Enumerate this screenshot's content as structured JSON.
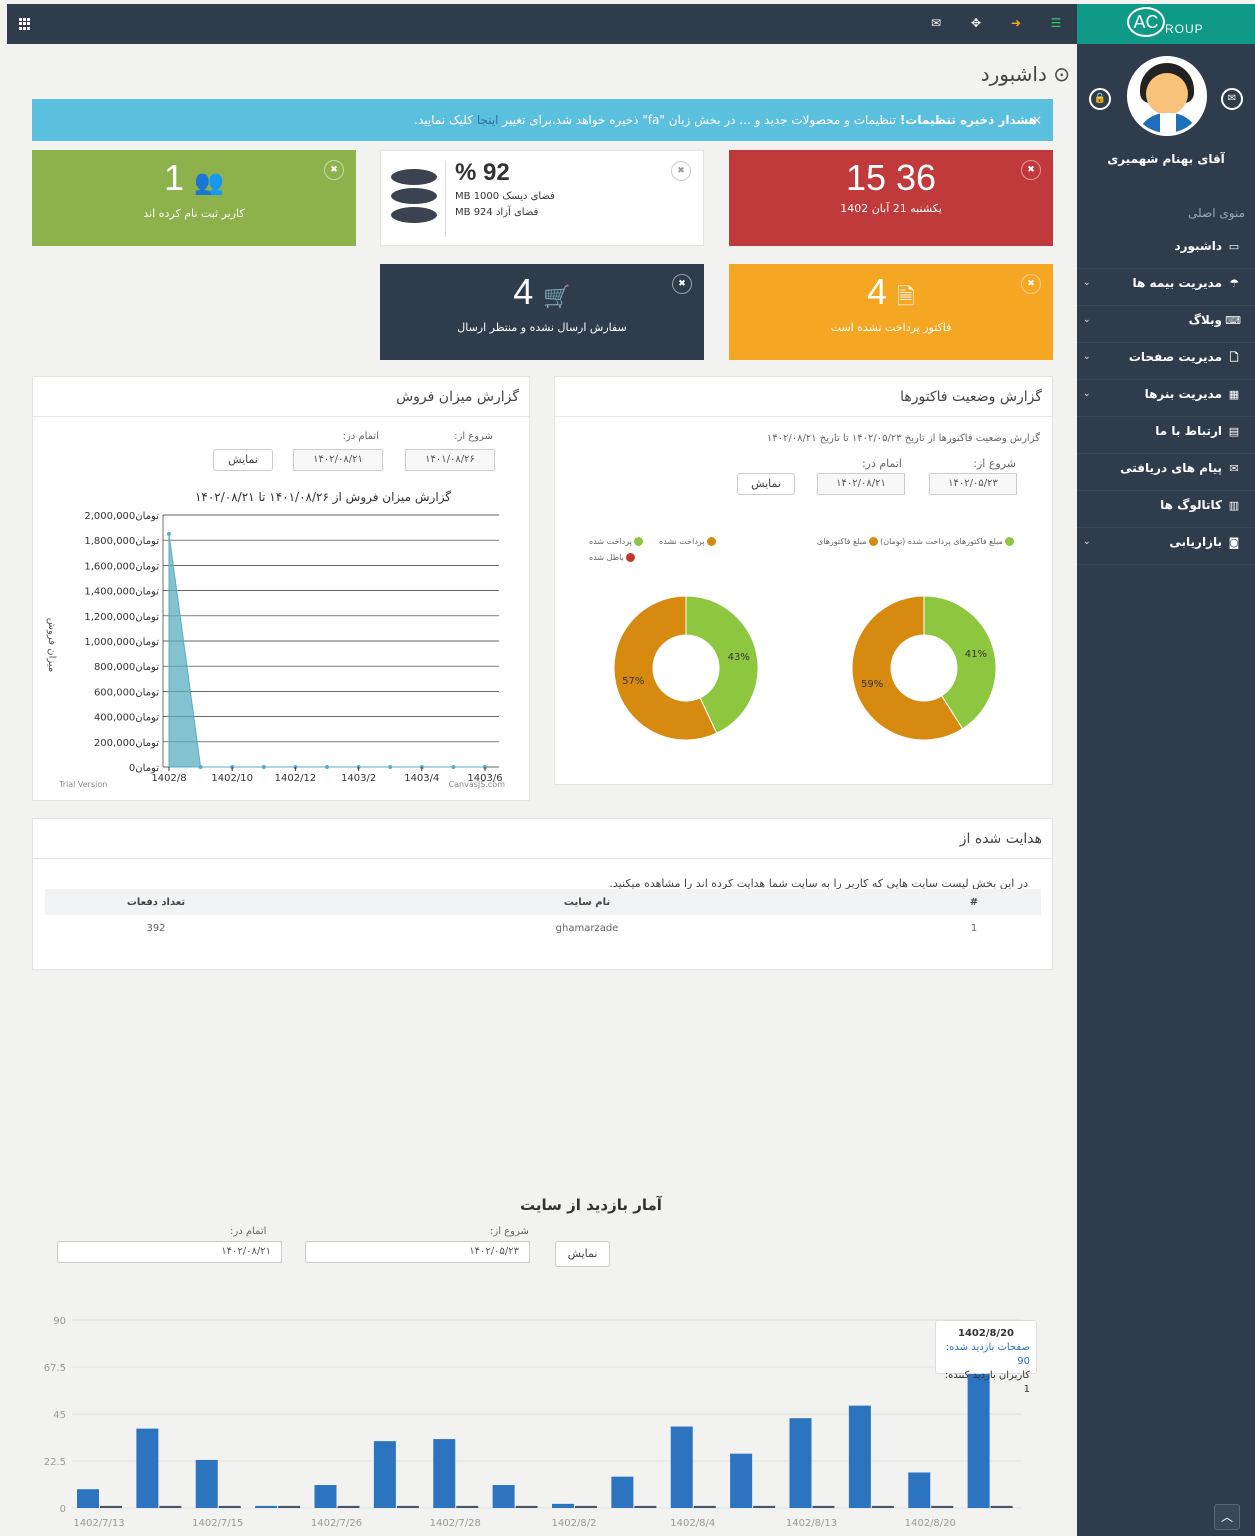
{
  "header": {
    "icons": [
      "apps-grid-icon",
      "envelope-icon",
      "crosshair-icon",
      "logout-icon",
      "list-icon"
    ]
  },
  "sidebar": {
    "logo_main": "AC",
    "logo_sub": "ROUP",
    "username": "آقای بهنام شهمیری",
    "menu_title": "منوی اصلی",
    "items": [
      {
        "label": "داشبورد",
        "icon": "monitor-icon",
        "has_sub": false
      },
      {
        "label": "مدیریت بیمه ها",
        "icon": "umbrella-icon",
        "has_sub": true
      },
      {
        "label": "وبلاگ",
        "icon": "keyboard-icon",
        "has_sub": true
      },
      {
        "label": "مدیریت صفحات",
        "icon": "file-icon",
        "has_sub": true
      },
      {
        "label": "مدیریت بنرها",
        "icon": "film-icon",
        "has_sub": true
      },
      {
        "label": "ارتباط با ما",
        "icon": "card-icon",
        "has_sub": false
      },
      {
        "label": "پیام های دریافتی",
        "icon": "envelope-icon",
        "has_sub": false
      },
      {
        "label": "کاتالوگ ها",
        "icon": "list-icon",
        "has_sub": false
      },
      {
        "label": "بازاریابی",
        "icon": "camera-icon",
        "has_sub": true
      }
    ]
  },
  "page": {
    "title": "داشبورد"
  },
  "alert": {
    "strong": "هشدار ذخیره تنظیمات!",
    "text": " تنظیمات و محصولات جدید و ... در بخش زبان \"fa\" ذخیره خواهد شد.برای تغییر ",
    "link": "اینجا",
    "tail": " کلیک نمایید."
  },
  "tiles": {
    "time": {
      "big": "15 36",
      "small": "یکشنبه 21 آبان 1402"
    },
    "disk": {
      "pct": "% 92",
      "line1": "فضای دیسک 1000 MB",
      "line2": "فضای آزاد 924 MB"
    },
    "users": {
      "big": "1",
      "small": "کاربر ثبت نام کرده اند"
    },
    "invoices": {
      "big": "4",
      "small": "فاکتور پرداخت نشده است"
    },
    "orders": {
      "big": "4",
      "small": "سفارش ارسال نشده و منتظر ارسال"
    }
  },
  "sales": {
    "title": "گزارش میزان فروش",
    "from_label": "شروع از:",
    "to_label": "اتمام در:",
    "from": "۱۴۰۱/۰۸/۲۶",
    "to": "۱۴۰۲/۰۸/۲۱",
    "button": "نمایش",
    "chart_title": "گزارش میزان فروش از ۱۴۰۱/۰۸/۲۶ تا ۱۴۰۲/۰۸/۲۱",
    "ylabel": "میزان فروش",
    "footer_left": "Trial Version",
    "footer_right": "CanvasJS.com"
  },
  "invoices": {
    "title": "گزارش وضعیت فاکتورها",
    "subtitle": "گزارش وضعیت فاکتورها از تاریخ ۱۴۰۲/۰۵/۲۳ تا تاریخ ۱۴۰۲/۰۸/۲۱",
    "from_label": "شروع از:",
    "to_label": "اتمام در:",
    "from": "۱۴۰۲/۰۵/۲۳",
    "to": "۱۴۰۲/۰۸/۲۱",
    "button": "نمایش",
    "legend_right_1": "مبلغ فاکتورهای پرداخت شده (تومان)",
    "legend_right_2": "مبلغ فاکتورهای",
    "legend_left_1": "پرداخت شده",
    "legend_left_2": "پرداخت نشده",
    "legend_left_3": "باطل شده"
  },
  "referrers": {
    "title": "هدایت شده از",
    "note": "در این بخش لیست سایت هایی که کاربر را به سایت شما هدایت کرده اند را مشاهده میکنید.",
    "columns": [
      "#",
      "نام سایت",
      "تعداد دفعات"
    ],
    "rows": [
      [
        "1",
        "ghamarzade",
        "392"
      ]
    ]
  },
  "visits": {
    "title": "آمار بازدید از سایت",
    "from_label": "شروع از:",
    "to_label": "اتمام در:",
    "from": "۱۴۰۲/۰۵/۲۳",
    "to": "۱۴۰۲/۰۸/۲۱",
    "button": "نمایش",
    "tooltip_date": "1402/8/20",
    "tooltip_pages": "صفحات بازدید شده: 90",
    "tooltip_users": "کاربران بازدید کننده: 1"
  },
  "chart_data": [
    {
      "type": "area",
      "title": "گزارش میزان فروش از ۱۴۰۱/۰۸/۲۶ تا ۱۴۰۲/۰۸/۲۱",
      "ylabel": "میزان فروش",
      "y_tick_unit": "تومان",
      "ylim": [
        0,
        2000000
      ],
      "y_ticks": [
        "0",
        "200,000",
        "400,000",
        "600,000",
        "800,000",
        "1,000,000",
        "1,200,000",
        "1,400,000",
        "1,600,000",
        "1,800,000",
        "2,000,000"
      ],
      "x_ticks": [
        "1402/8",
        "1402/10",
        "1402/12",
        "1403/2",
        "1403/4",
        "1403/6"
      ],
      "x": [
        "1402/8",
        "1402/9",
        "1402/10",
        "1402/11",
        "1402/12",
        "1403/1",
        "1403/2",
        "1403/3",
        "1403/4",
        "1403/5",
        "1403/6"
      ],
      "values": [
        1850000,
        0,
        0,
        0,
        0,
        0,
        0,
        0,
        0,
        0,
        0
      ],
      "color": "#5aaec2"
    },
    {
      "type": "pie",
      "donut": true,
      "slices": [
        {
          "label": "43%",
          "value": 43,
          "color": "#8dc63f"
        },
        {
          "label": "57%",
          "value": 57,
          "color": "#d68b10"
        }
      ]
    },
    {
      "type": "pie",
      "donut": true,
      "slices": [
        {
          "label": "41%",
          "value": 41,
          "color": "#8dc63f"
        },
        {
          "label": "59%",
          "value": 59,
          "color": "#d68b10"
        }
      ]
    },
    {
      "type": "bar",
      "ylim": [
        0,
        90
      ],
      "y_ticks": [
        "0",
        "22.5",
        "45",
        "67.5",
        "90"
      ],
      "categories": [
        "1402/7/13",
        "",
        "1402/7/15",
        "",
        "1402/7/26",
        "",
        "1402/7/28",
        "",
        "1402/8/2",
        "",
        "1402/8/4",
        "",
        "1402/8/13",
        "",
        "1402/8/20",
        ""
      ],
      "series": [
        {
          "color": "#2c74c0",
          "values": [
            9,
            38,
            23,
            1,
            11,
            32,
            33,
            11,
            2,
            15,
            39,
            26,
            43,
            49,
            17,
            90
          ]
        },
        {
          "color": "#4a5563",
          "values": [
            1,
            1,
            1,
            1,
            1,
            1,
            1,
            1,
            1,
            1,
            1,
            1,
            1,
            1,
            1,
            1
          ]
        }
      ]
    }
  ]
}
